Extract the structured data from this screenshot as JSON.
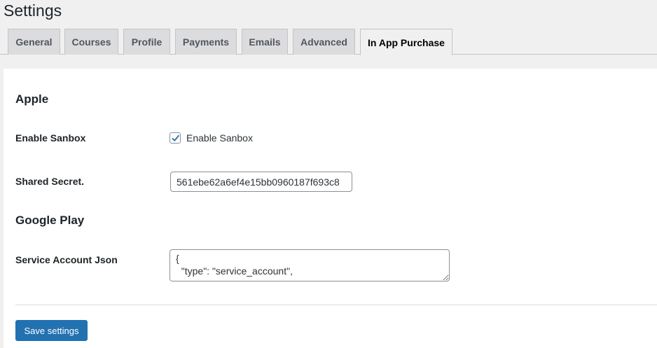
{
  "page": {
    "title": "Settings"
  },
  "tabs": [
    {
      "label": "General"
    },
    {
      "label": "Courses"
    },
    {
      "label": "Profile"
    },
    {
      "label": "Payments"
    },
    {
      "label": "Emails"
    },
    {
      "label": "Advanced"
    },
    {
      "label": "In App Purchase",
      "active": true
    }
  ],
  "apple": {
    "heading": "Apple",
    "sandbox": {
      "label": "Enable Sanbox",
      "checkbox_label": "Enable Sanbox",
      "checked": true
    },
    "shared_secret": {
      "label": "Shared Secret.",
      "value": "561ebe62a6ef4e15bb0960187f693c8"
    }
  },
  "google": {
    "heading": "Google Play",
    "service_account": {
      "label": "Service Account Json",
      "value": "{\n  \"type\": \"service_account\","
    }
  },
  "actions": {
    "save_label": "Save settings"
  },
  "colors": {
    "primary": "#2271b1",
    "background": "#f0f0f1",
    "panel": "#ffffff",
    "tab_inactive": "#dcdcde"
  },
  "icons": {
    "checkbox": "checkmark-icon"
  }
}
